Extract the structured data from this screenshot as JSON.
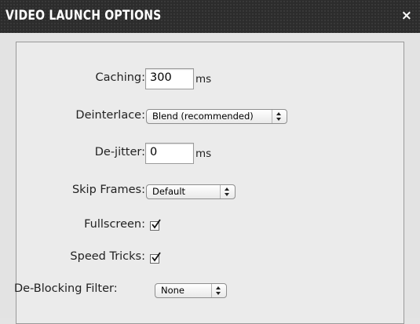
{
  "window": {
    "title": "VIDEO LAUNCH OPTIONS",
    "close_glyph": "×",
    "close_icon": "close-icon"
  },
  "form": {
    "caching": {
      "label": "Caching:",
      "value": "300",
      "unit": "ms"
    },
    "deinterlace": {
      "label": "Deinterlace:",
      "selected": "Blend (recommended)"
    },
    "dejitter": {
      "label": "De-jitter:",
      "value": "0",
      "unit": "ms"
    },
    "skip_frames": {
      "label": "Skip Frames:",
      "selected": "Default"
    },
    "fullscreen": {
      "label": "Fullscreen:",
      "checked": true
    },
    "speed_tricks": {
      "label": "Speed Tricks:",
      "checked": true
    },
    "deblocking": {
      "label": "De-Blocking Filter:",
      "selected": "None"
    }
  }
}
